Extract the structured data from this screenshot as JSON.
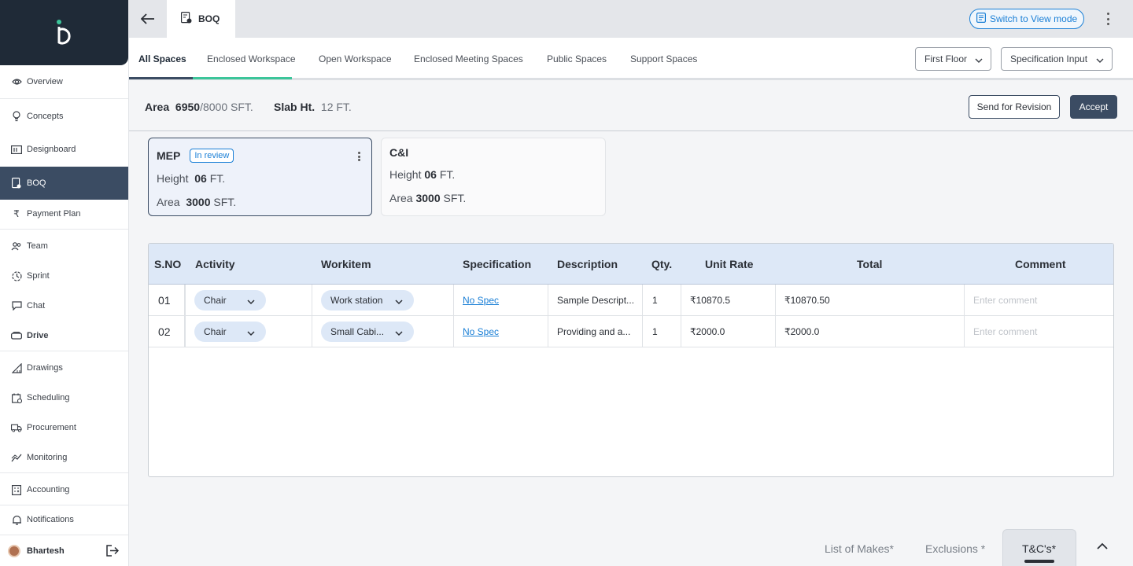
{
  "sidebar": {
    "items": [
      {
        "label": "Overview",
        "icon": "eye-icon"
      },
      {
        "label": "Concepts",
        "icon": "lightbulb-icon"
      },
      {
        "label": "Designboard",
        "icon": "board-icon"
      },
      {
        "label": "BOQ",
        "icon": "boq-icon"
      },
      {
        "label": "Payment Plan",
        "icon": "rupee-icon"
      },
      {
        "label": "Team",
        "icon": "team-icon"
      },
      {
        "label": "Sprint",
        "icon": "sprint-icon"
      },
      {
        "label": "Chat",
        "icon": "chat-icon"
      },
      {
        "label": "Drive",
        "icon": "drive-icon"
      },
      {
        "label": "Drawings",
        "icon": "drawings-icon"
      },
      {
        "label": "Scheduling",
        "icon": "calendar-icon"
      },
      {
        "label": "Procurement",
        "icon": "truck-icon"
      },
      {
        "label": "Monitoring",
        "icon": "chart-line-icon"
      },
      {
        "label": "Accounting",
        "icon": "calculator-icon"
      },
      {
        "label": "Notifications",
        "icon": "bell-icon"
      }
    ],
    "user": {
      "name": "Bhartesh"
    }
  },
  "topbar": {
    "tab_label": "BOQ",
    "switch_label": "Switch to View mode"
  },
  "space_tabs": [
    "All Spaces",
    "Enclosed Workspace",
    "Open Workspace",
    "Enclosed Meeting Spaces",
    "Public Spaces",
    "Support Spaces"
  ],
  "filters": {
    "floor": "First Floor",
    "mode": "Specification Input"
  },
  "area": {
    "label": "Area",
    "used": "6950",
    "total": "/8000",
    "unit": "SFT.",
    "slab_label": "Slab Ht.",
    "slab_value": "12 FT."
  },
  "actions": {
    "revision": "Send for Revision",
    "accept": "Accept"
  },
  "cards": [
    {
      "title": "MEP",
      "badge": "In review",
      "height_label": "Height",
      "height_value": "06",
      "height_unit": "FT.",
      "area_label": "Area",
      "area_value": "3000",
      "area_unit": "SFT."
    },
    {
      "title": "C&I",
      "height_label": "Height",
      "height_value": "06",
      "height_unit": "FT.",
      "area_label": "Area",
      "area_value": "3000",
      "area_unit": "SFT."
    }
  ],
  "table": {
    "headers": [
      "S.NO",
      "Activity",
      "Workitem",
      "Specification",
      "Description",
      "Qty.",
      "Unit Rate",
      "Total",
      "Comment"
    ],
    "rows": [
      {
        "sno": "01",
        "activity": "Chair",
        "workitem": "Work station",
        "spec": "No Spec",
        "description": "Sample Descript...",
        "qty": "1",
        "unit_rate": "₹10870.5",
        "total": "₹10870.50",
        "comment_placeholder": "Enter comment"
      },
      {
        "sno": "02",
        "activity": "Chair",
        "workitem": "Small Cabi...",
        "spec": "No Spec",
        "description": "Providing and a...",
        "qty": "1",
        "unit_rate": "₹2000.0",
        "total": "₹2000.0",
        "comment_placeholder": "Enter comment"
      }
    ]
  },
  "bottom_tabs": [
    "List of Makes*",
    "Exclusions *",
    "T&C's*"
  ],
  "colors": {
    "primary": "#3b4c63",
    "accent_blue": "#1a7fd6",
    "progress_green": "#3cc59a",
    "header_bg": "#dde8f7"
  }
}
